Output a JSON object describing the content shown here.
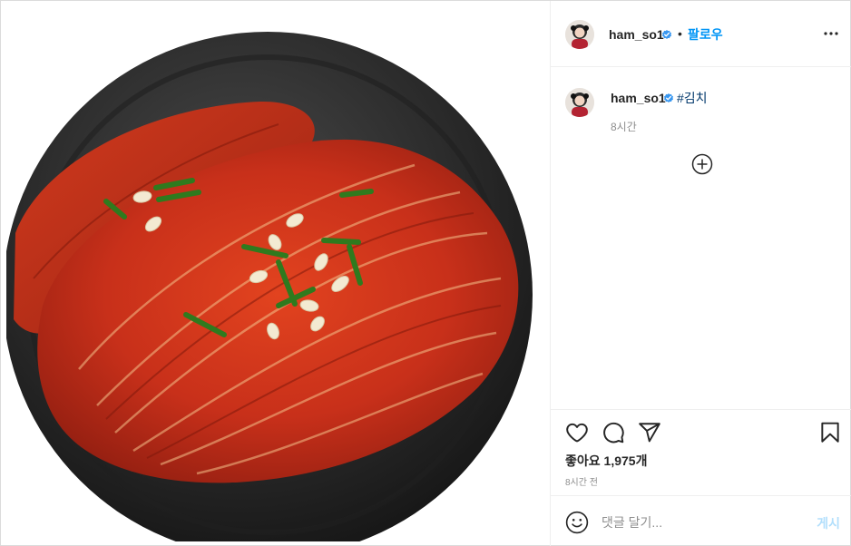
{
  "post": {
    "image_alt": "Kimchi on a dark plate",
    "author": {
      "username": "ham_so1",
      "verified": true,
      "follow_label": "팔로우",
      "separator": "•"
    },
    "caption": {
      "username": "ham_so1",
      "text": "#김치",
      "time": "8시간"
    },
    "likes_text": "좋아요 1,975개",
    "time_text": "8시간 전",
    "comment_placeholder": "댓글 달기...",
    "post_label": "게시"
  },
  "icons": {
    "more": "more-options-icon",
    "heart": "heart-icon",
    "comment": "comment-icon",
    "share": "share-icon",
    "save": "bookmark-icon",
    "emoji": "emoji-icon",
    "load_more": "plus-circle-icon",
    "verified": "verified-badge-icon"
  },
  "colors": {
    "link_blue": "#0095f6",
    "hashtag": "#00376b",
    "verified_blue": "#3897f0",
    "muted": "#8e8e8e",
    "disabled_post": "#b2dffc"
  }
}
